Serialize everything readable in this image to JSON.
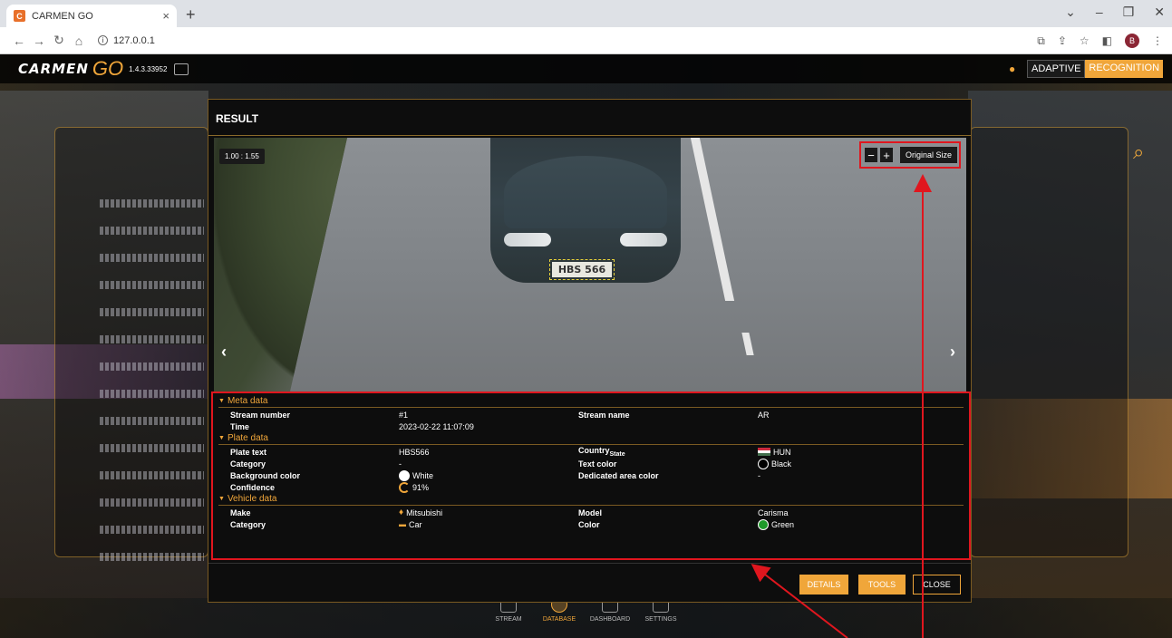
{
  "browser": {
    "tab_title": "CARMEN GO",
    "tab_close": "×",
    "new_tab": "+",
    "url": "127.0.0.1",
    "profile_initial": "B"
  },
  "app": {
    "logo_text": "CARMEN",
    "logo_go": "GO",
    "version": "1.4.3.33952",
    "brand_left": "ADAPTIVE",
    "brand_right": "RECOGNITION"
  },
  "nav": [
    {
      "label": "STREAM",
      "icon": "stream-icon"
    },
    {
      "label": "DATABASE",
      "icon": "database-icon"
    },
    {
      "label": "DASHBOARD",
      "icon": "dashboard-icon"
    },
    {
      "label": "SETTINGS",
      "icon": "settings-icon"
    }
  ],
  "modal": {
    "title": "RESULT",
    "zoom_level": "1.00 : 1.55",
    "zoom_out": "−",
    "zoom_in": "+",
    "original_size": "Original Size",
    "plate_overlay": "HBS 566",
    "prev_arrow": "‹",
    "next_arrow": "›"
  },
  "meta": {
    "header": "Meta data",
    "stream_number_label": "Stream number",
    "stream_number": "#1",
    "stream_name_label": "Stream name",
    "stream_name": "AR",
    "time_label": "Time",
    "time": "2023-02-22 11:07:09"
  },
  "plate": {
    "header": "Plate data",
    "plate_text_label": "Plate text",
    "plate_text": "HBS566",
    "country_label": "Country",
    "country_sub": "State",
    "country": "HUN",
    "category_label": "Category",
    "category": "-",
    "text_color_label": "Text color",
    "text_color": "Black",
    "bg_color_label": "Background color",
    "bg_color": "White",
    "dedicated_label": "Dedicated area color",
    "dedicated": "-",
    "confidence_label": "Confidence",
    "confidence": "91%"
  },
  "vehicle": {
    "header": "Vehicle data",
    "make_label": "Make",
    "make": "Mitsubishi",
    "model_label": "Model",
    "model": "Carisma",
    "category_label": "Category",
    "category": "Car",
    "color_label": "Color",
    "color": "Green"
  },
  "buttons": {
    "details": "DETAILS",
    "tools": "TOOLS",
    "close": "CLOSE"
  },
  "colors": {
    "accent": "#f0a63a",
    "annotation": "#e0161e",
    "swatch_black": "#000000",
    "swatch_white": "#ffffff",
    "swatch_green": "#1e9a2a"
  }
}
